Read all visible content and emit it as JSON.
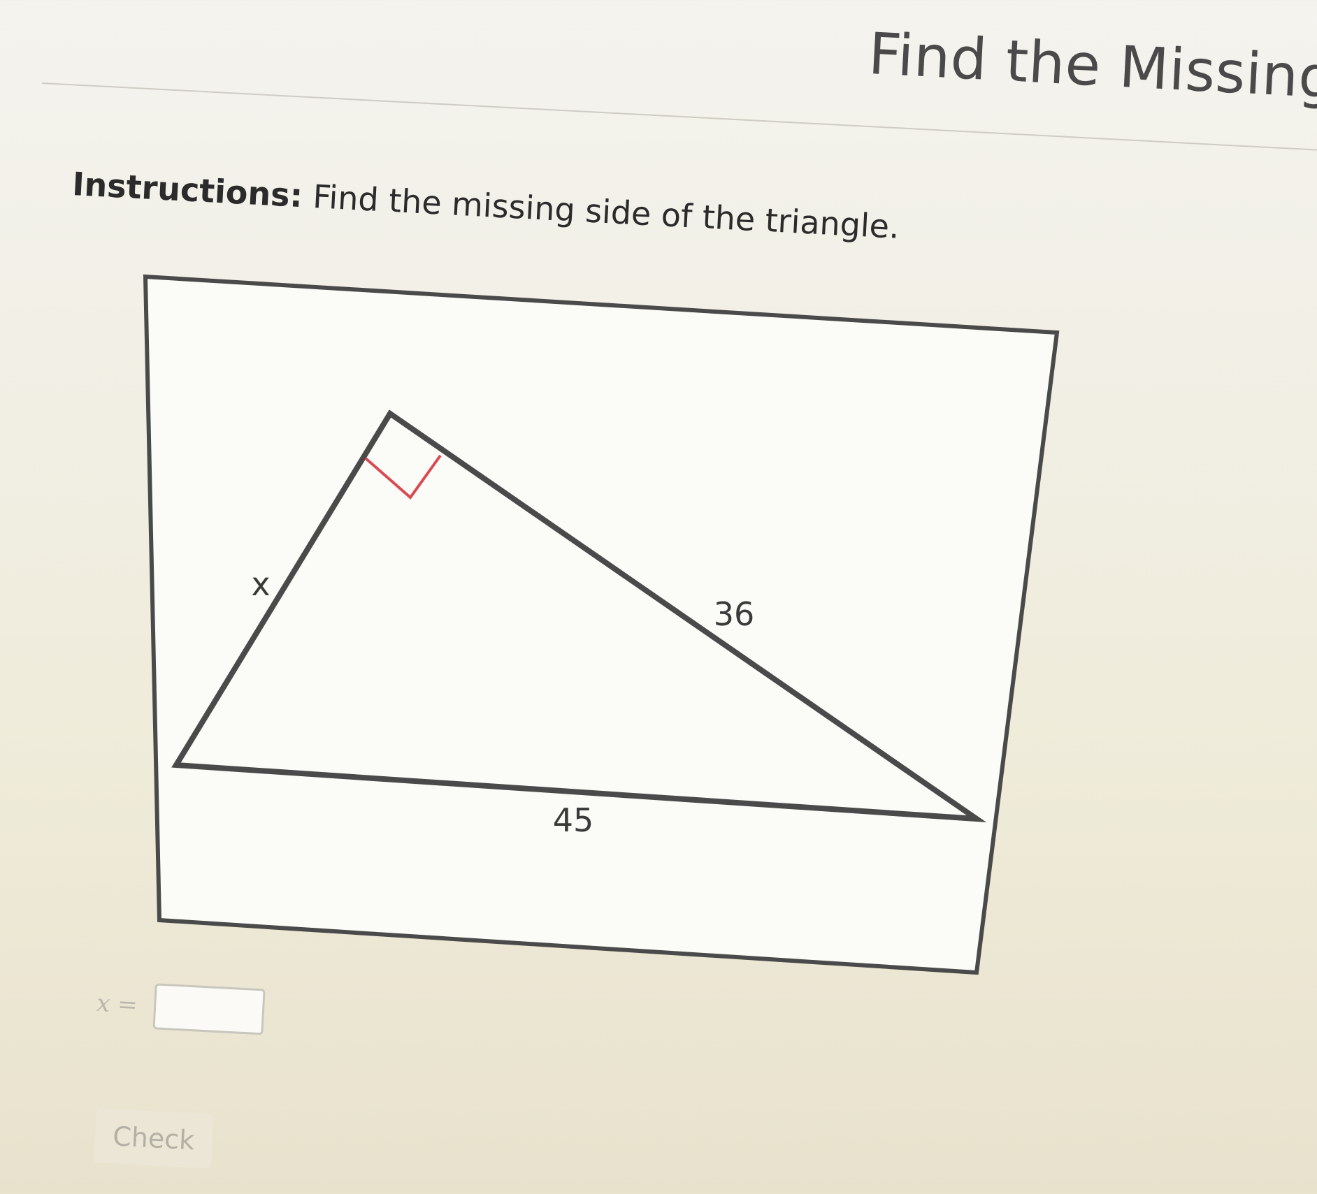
{
  "header": {
    "title": "Find the Missing Si"
  },
  "instructions": {
    "label": "Instructions:",
    "text": " Find the missing side of the triangle."
  },
  "diagram": {
    "side_labels": {
      "left_leg": "x",
      "hypotenuse_side": "36",
      "base": "45"
    },
    "right_angle_marker_color": "#d94b52",
    "stroke_color": "#4a4a4a"
  },
  "answer": {
    "variable_label": "x =",
    "value": ""
  },
  "check_button": {
    "label": "Check"
  }
}
